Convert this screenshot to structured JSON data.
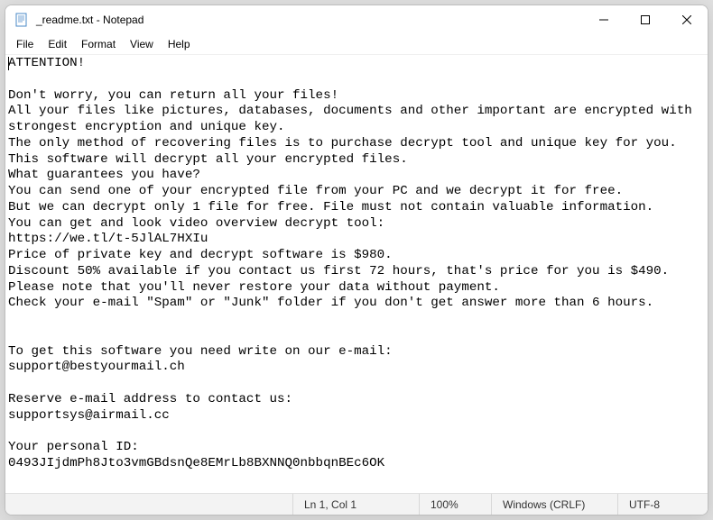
{
  "window": {
    "title": "_readme.txt - Notepad"
  },
  "menu": {
    "file": "File",
    "edit": "Edit",
    "format": "Format",
    "view": "View",
    "help": "Help"
  },
  "document": {
    "text": "ATTENTION!\n\nDon't worry, you can return all your files!\nAll your files like pictures, databases, documents and other important are encrypted with strongest encryption and unique key.\nThe only method of recovering files is to purchase decrypt tool and unique key for you.\nThis software will decrypt all your encrypted files.\nWhat guarantees you have?\nYou can send one of your encrypted file from your PC and we decrypt it for free.\nBut we can decrypt only 1 file for free. File must not contain valuable information.\nYou can get and look video overview decrypt tool:\nhttps://we.tl/t-5JlAL7HXIu\nPrice of private key and decrypt software is $980.\nDiscount 50% available if you contact us first 72 hours, that's price for you is $490.\nPlease note that you'll never restore your data without payment.\nCheck your e-mail \"Spam\" or \"Junk\" folder if you don't get answer more than 6 hours.\n\n\nTo get this software you need write on our e-mail:\nsupport@bestyourmail.ch\n\nReserve e-mail address to contact us:\nsupportsys@airmail.cc\n\nYour personal ID:\n0493JIjdmPh8Jto3vmGBdsnQe8EMrLb8BXNNQ0nbbqnBEc6OK"
  },
  "status": {
    "position": "Ln 1, Col 1",
    "zoom": "100%",
    "line_ending": "Windows (CRLF)",
    "encoding": "UTF-8"
  }
}
